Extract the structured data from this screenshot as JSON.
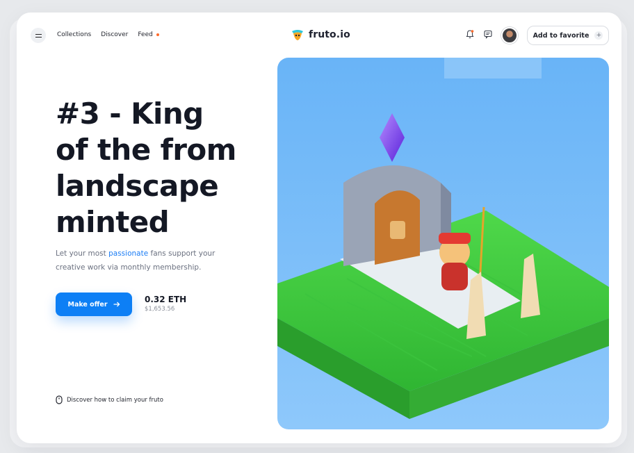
{
  "nav": {
    "items": [
      {
        "label": "Collections"
      },
      {
        "label": "Discover"
      },
      {
        "label": "Feed",
        "has_dot": true
      }
    ]
  },
  "brand": {
    "name": "fruto.io"
  },
  "header": {
    "favorite_label": "Add to favorite"
  },
  "hero": {
    "headline_lines": [
      "#3 - King",
      "of the from",
      "landscape",
      "minted"
    ],
    "subtitle_pre": "Let your most ",
    "subtitle_highlight": "passionate",
    "subtitle_post": " fans support your creative work via monthly membership.",
    "offer_label": "Make offer",
    "price_eth": "0.32 ETH",
    "price_usd": "$1,653.56",
    "claim_label": "Discover how to claim your fruto"
  },
  "colors": {
    "accent": "#0d7ff5",
    "feed_dot": "#ff6a2a",
    "headline": "#141824",
    "art_sky": "#6fb8f8"
  },
  "icons": [
    "menu-icon",
    "logo-icon",
    "bell-icon",
    "chat-icon",
    "plus-icon",
    "arrow-right-icon",
    "mouse-icon"
  ]
}
